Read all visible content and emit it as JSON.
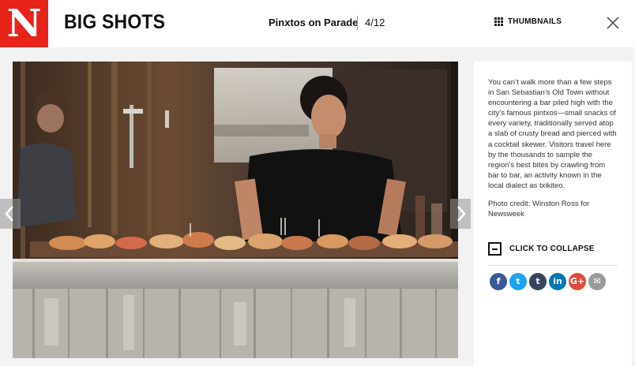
{
  "header": {
    "logo_letter": "N",
    "section_title": "BIG SHOTS",
    "gallery_title": "Pinxtos on Parade",
    "counter": "4/12",
    "thumbnails_label": "THUMBNAILS"
  },
  "caption": {
    "text": "You can’t walk more than a few steps in San Sebastian’s Old Town without encountering a bar piled high with the city’s famous pintxos—small snacks of every variety, traditionally served atop a slab of crusty bread and pierced with a cocktail skewer. Visitors travel here by the thousands to sample the region’s best bites by crawling from bar to bar, an activity known in the local dialect as txikiteo.",
    "credit": "Photo credit: Winston Ross for Newsweek",
    "collapse_label": "CLICK TO COLLAPSE"
  },
  "social": [
    {
      "icon": "facebook-icon",
      "glyph": "f",
      "color": "#3b5998"
    },
    {
      "icon": "twitter-icon",
      "glyph": "t",
      "color": "#1da1f2"
    },
    {
      "icon": "tumblr-icon",
      "glyph": "t",
      "color": "#35465c"
    },
    {
      "icon": "linkedin-icon",
      "glyph": "in",
      "color": "#0077b5"
    },
    {
      "icon": "googleplus-icon",
      "glyph": "G+",
      "color": "#dd4b39"
    },
    {
      "icon": "email-icon",
      "glyph": "✉",
      "color": "#999999"
    }
  ],
  "colors": {
    "brand": "#e8231a"
  }
}
